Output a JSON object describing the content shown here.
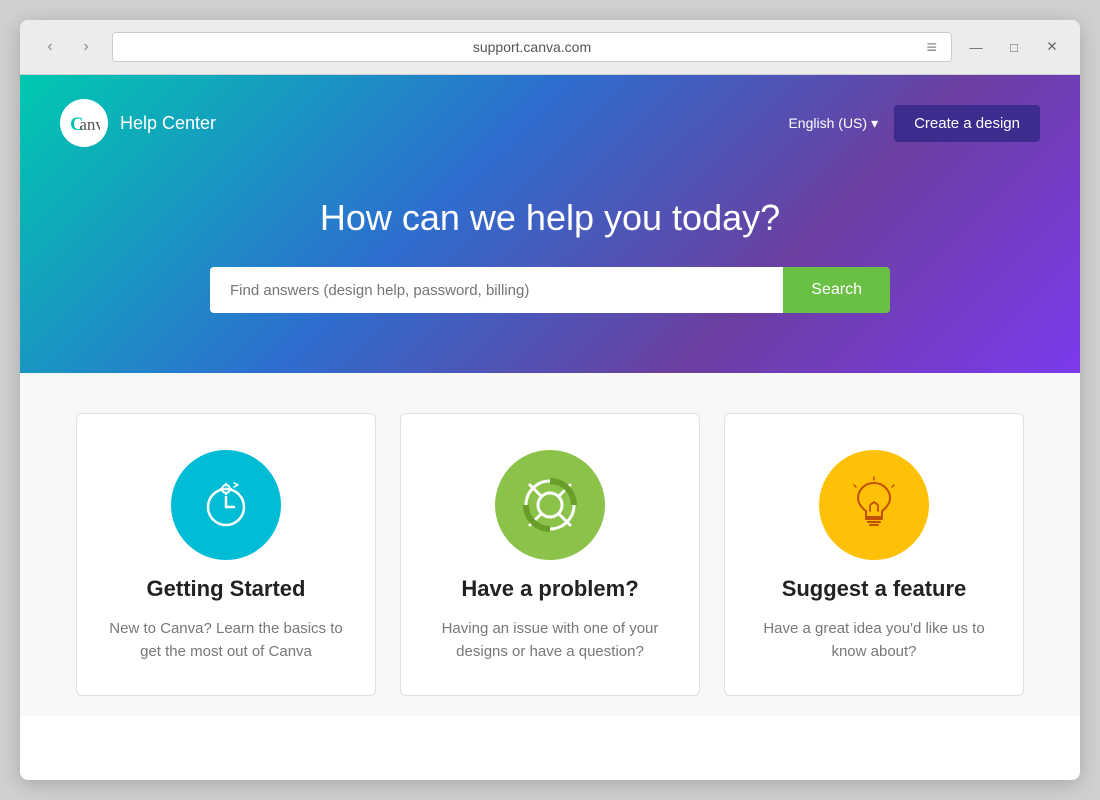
{
  "browser": {
    "url": "support.canva.com",
    "menu_icon": "≡",
    "nav": {
      "back_label": "‹",
      "forward_label": "›",
      "minimize_label": "—",
      "restore_label": "□",
      "close_label": "✕"
    }
  },
  "header": {
    "logo_alt": "Canva",
    "help_center_label": "Help Center",
    "language_label": "English (US)",
    "create_design_label": "Create a design"
  },
  "hero": {
    "title": "How can we help you today?",
    "search_placeholder": "Find answers (design help, password, billing)",
    "search_button_label": "Search"
  },
  "cards": [
    {
      "id": "getting-started",
      "title": "Getting Started",
      "description": "New to Canva? Learn the basics to get the most out of Canva",
      "icon_color": "#00bcd4"
    },
    {
      "id": "have-a-problem",
      "title": "Have a problem?",
      "description": "Having an issue with one of your designs or have a question?",
      "icon_color": "#8bc34a"
    },
    {
      "id": "suggest-feature",
      "title": "Suggest a feature",
      "description": "Have a great idea you'd like us to know about?",
      "icon_color": "#ffc107"
    }
  ]
}
